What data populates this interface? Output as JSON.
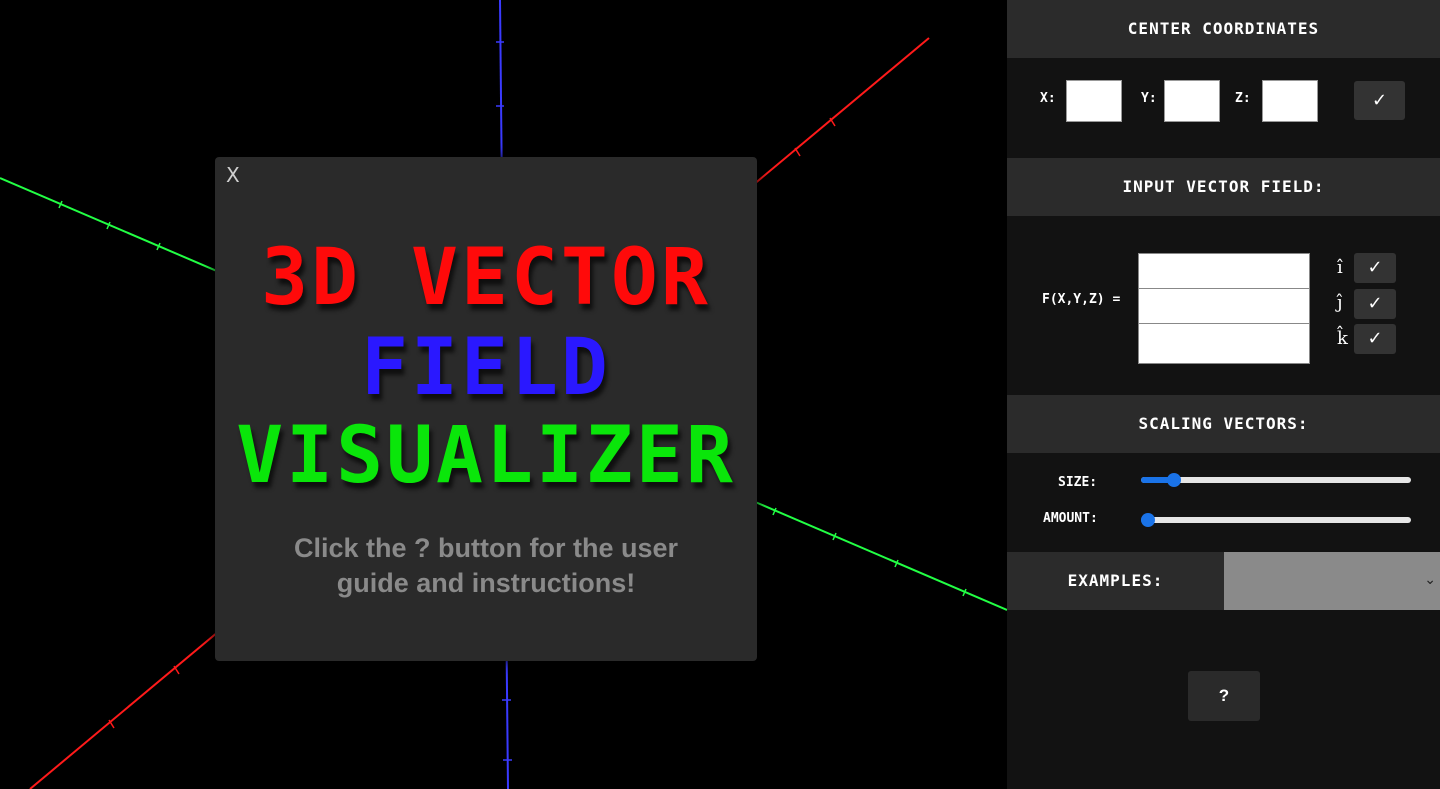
{
  "modal": {
    "close_label": "X",
    "title_lines": [
      "3D VECTOR",
      "FIELD",
      "VISUALIZER"
    ],
    "hint": "Click the ? button for the user guide and instructions!"
  },
  "center": {
    "heading": "CENTER COORDINATES",
    "x_label": "X:",
    "y_label": "Y:",
    "z_label": "Z:",
    "x_value": "",
    "y_value": "",
    "z_value": "",
    "confirm_label": "✓"
  },
  "vector_field": {
    "heading": "INPUT VECTOR FIELD:",
    "function_label": "F(X,Y,Z) =",
    "i_unit": "î",
    "j_unit": "ĵ",
    "k_unit": "k̂",
    "i_value": "",
    "j_value": "",
    "k_value": "",
    "confirm_label": "✓"
  },
  "scaling": {
    "heading": "SCALING VECTORS:",
    "size_label": "SIZE:",
    "amount_label": "AMOUNT:",
    "size_level": 0.1,
    "amount_level": 0.0
  },
  "examples": {
    "label": "EXAMPLES:",
    "selected": "",
    "chevron": "⌄"
  },
  "help": {
    "label": "?"
  },
  "colors": {
    "x_axis": "#ff1a1a",
    "y_axis": "#1a1aff",
    "z_axis": "#22ff44",
    "accent": "#1a73e8"
  }
}
